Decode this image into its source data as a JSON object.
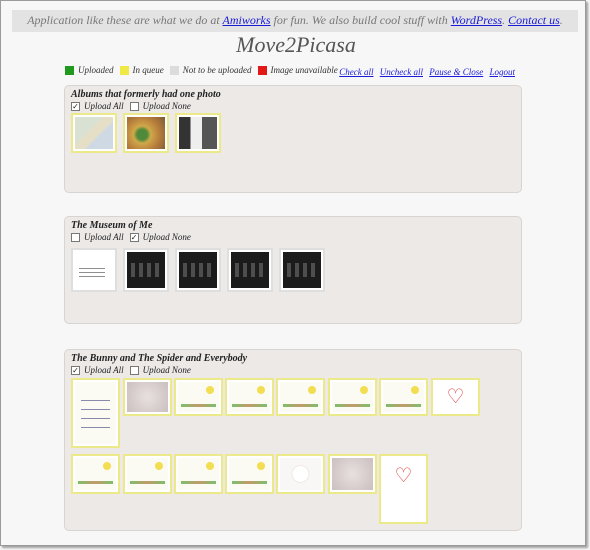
{
  "banner": {
    "prefix": "Application like these are what we do at",
    "amiworks": "Amiworks",
    "middle": "for fun. We also build cool stuff with",
    "wordpress": "WordPress",
    "dot": ".",
    "contact": "Contact us",
    "end": "."
  },
  "title": "Move2Picasa",
  "legend": [
    {
      "label": "Uploaded",
      "color": "#1f9a1f"
    },
    {
      "label": "In queue",
      "color": "#efe845"
    },
    {
      "label": "Not to be uploaded",
      "color": "#dcdcdc"
    },
    {
      "label": "Image unavailable",
      "color": "#e01818"
    }
  ],
  "links": {
    "check_all": "Check all",
    "uncheck_all": "Uncheck all",
    "pause_close": "Pause & Close",
    "logout": "Logout"
  },
  "albums": [
    {
      "title": "Albums that formerly had one photo",
      "upload_all": "Upload All",
      "upload_none": "Upload None",
      "upload_all_checked": true,
      "upload_none_checked": false
    },
    {
      "title": "The Museum of Me",
      "upload_all": "Upload All",
      "upload_none": "Upload None",
      "upload_all_checked": false,
      "upload_none_checked": true
    },
    {
      "title": "The Bunny and The Spider and Everybody",
      "upload_all": "Upload All",
      "upload_none": "Upload None",
      "upload_all_checked": true,
      "upload_none_checked": false
    }
  ]
}
